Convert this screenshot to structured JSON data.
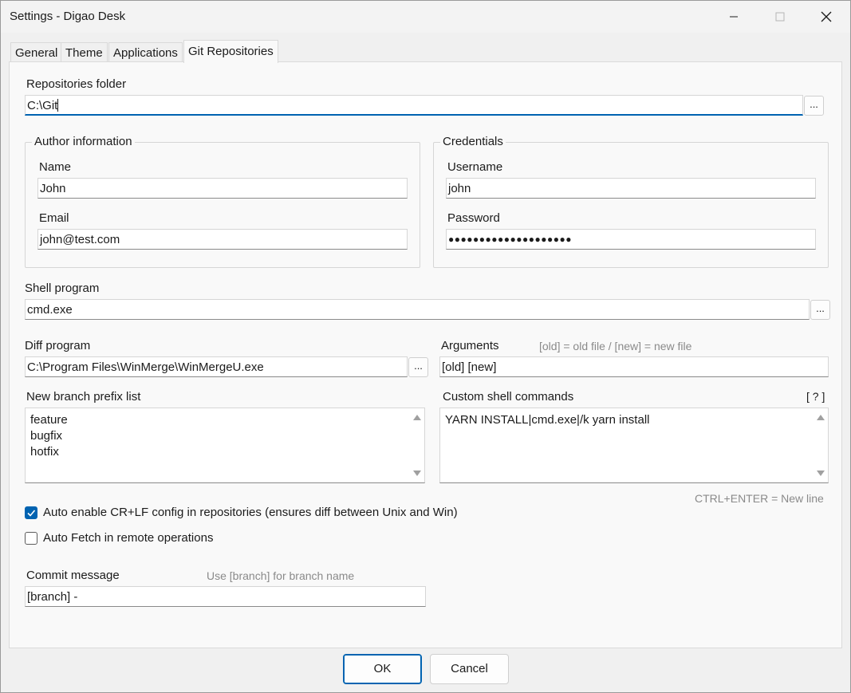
{
  "window": {
    "title": "Settings - Digao Desk"
  },
  "tabs": [
    {
      "label": "General"
    },
    {
      "label": "Theme"
    },
    {
      "label": "Applications"
    },
    {
      "label": "Git Repositories"
    }
  ],
  "repos": {
    "label": "Repositories folder",
    "value": "C:\\Git",
    "browse": "..."
  },
  "author": {
    "title": "Author information",
    "name_label": "Name",
    "name_value": "John",
    "email_label": "Email",
    "email_value": "john@test.com"
  },
  "credentials": {
    "title": "Credentials",
    "username_label": "Username",
    "username_value": "john",
    "password_label": "Password",
    "password_value": "●●●●●●●●●●●●●●●●●●●●"
  },
  "shell": {
    "label": "Shell program",
    "value": "cmd.exe",
    "browse": "..."
  },
  "diff": {
    "label": "Diff program",
    "value": "C:\\Program Files\\WinMerge\\WinMergeU.exe",
    "browse": "..."
  },
  "arguments": {
    "label": "Arguments",
    "hint": "[old] = old file / [new] = new file",
    "value": "[old] [new]"
  },
  "branch_prefix": {
    "label": "New branch prefix list",
    "lines": [
      "feature",
      "bugfix",
      "hotfix"
    ]
  },
  "custom_shell": {
    "label": "Custom shell commands",
    "help": "[ ? ]",
    "lines": [
      "YARN INSTALL|cmd.exe|/k yarn install"
    ],
    "hint": "CTRL+ENTER = New line"
  },
  "options": {
    "crlf_label": "Auto enable CR+LF config in repositories (ensures diff between Unix and Win)",
    "crlf_checked": true,
    "fetch_label": "Auto Fetch in remote operations",
    "fetch_checked": false
  },
  "commit": {
    "label": "Commit message",
    "hint": "Use [branch] for branch name",
    "value": "[branch] -"
  },
  "buttons": {
    "ok": "OK",
    "cancel": "Cancel"
  }
}
